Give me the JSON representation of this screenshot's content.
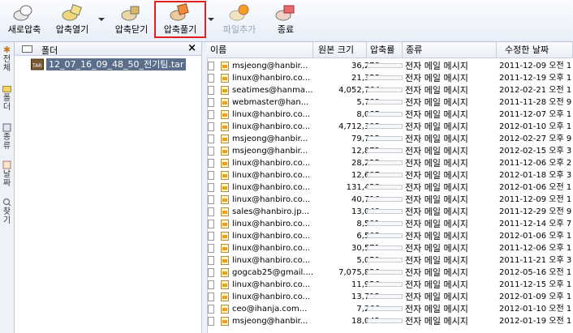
{
  "toolbar": {
    "new_label": "새로압축",
    "open_label": "압축열기",
    "close_label": "압축닫기",
    "extract_label": "압축풀기",
    "add_label": "파일추가",
    "exit_label": "종료"
  },
  "vtabs": {
    "all": "전체",
    "folder": "폴더",
    "type": "종류",
    "date": "날짜",
    "find": "찾기"
  },
  "folder_pane": {
    "title": "폴더",
    "close": "×",
    "item": "12_07_16_09_48_50_전기팀.tar"
  },
  "list": {
    "columns": {
      "name": "이름",
      "size": "원본 크기",
      "ratio": "압축률",
      "type": "종류",
      "date": "수정한 날짜"
    },
    "rows": [
      {
        "name": "msjeong@hanbir...",
        "size": "36,278",
        "type": "전자 메일 메시지",
        "date": "2011-12-09 오전 1"
      },
      {
        "name": "linux@hanbiro.co...",
        "size": "21,353",
        "type": "전자 메일 메시지",
        "date": "2011-12-19 오후 1"
      },
      {
        "name": "seatimes@hanma...",
        "size": "4,052,764",
        "type": "전자 메일 메시지",
        "date": "2012-02-21 오전 1"
      },
      {
        "name": "webmaster@han...",
        "size": "5,789",
        "type": "전자 메일 메시지",
        "date": "2011-11-28 오전 9"
      },
      {
        "name": "linux@hanbiro.co...",
        "size": "8,085",
        "type": "전자 메일 메시지",
        "date": "2011-12-07 오후 1"
      },
      {
        "name": "linux@hanbiro.co...",
        "size": "4,712,393",
        "type": "전자 메일 메시지",
        "date": "2012-01-10 오후 1"
      },
      {
        "name": "msjeong@hanbir...",
        "size": "79,712",
        "type": "전자 메일 메시지",
        "date": "2012-02-27 오후 9"
      },
      {
        "name": "msjeong@hanbir...",
        "size": "12,872",
        "type": "전자 메일 메시지",
        "date": "2012-02-15 오후 3"
      },
      {
        "name": "linux@hanbiro.co...",
        "size": "28,225",
        "type": "전자 메일 메시지",
        "date": "2011-12-06 오후 2"
      },
      {
        "name": "linux@hanbiro.co...",
        "size": "12,697",
        "type": "전자 메일 메시지",
        "date": "2012-01-18 오후 3"
      },
      {
        "name": "linux@hanbiro.co...",
        "size": "131,428",
        "type": "전자 메일 메시지",
        "date": "2012-01-06 오전 1"
      },
      {
        "name": "linux@hanbiro.co...",
        "size": "40,716",
        "type": "전자 메일 메시지",
        "date": "2011-12-09 오전 1"
      },
      {
        "name": "sales@hanbiro.jp...",
        "size": "13,040",
        "type": "전자 메일 메시지",
        "date": "2011-12-29 오전 9"
      },
      {
        "name": "linux@hanbiro.co...",
        "size": "8,591",
        "type": "전자 메일 메시지",
        "date": "2011-12-14 오후 7"
      },
      {
        "name": "linux@hanbiro.co...",
        "size": "6,503",
        "type": "전자 메일 메시지",
        "date": "2012-01-06 오후 1"
      },
      {
        "name": "linux@hanbiro.co...",
        "size": "30,571",
        "type": "전자 메일 메시지",
        "date": "2011-12-06 오후 1"
      },
      {
        "name": "linux@hanbiro.co...",
        "size": "5,059",
        "type": "전자 메일 메시지",
        "date": "2011-11-21 오후 3"
      },
      {
        "name": "gogcab25@gmail....",
        "size": "7,075,826",
        "type": "전자 메일 메시지",
        "date": "2012-05-16 오전 1"
      },
      {
        "name": "linux@hanbiro.co...",
        "size": "11,926",
        "type": "전자 메일 메시지",
        "date": "2011-12-15 오후 1"
      },
      {
        "name": "linux@hanbiro.co...",
        "size": "13,712",
        "type": "전자 메일 메시지",
        "date": "2012-01-09 오후 1"
      },
      {
        "name": "ceo@ihanja.com...",
        "size": "7,266",
        "type": "전자 메일 메시지",
        "date": "2012-01-10 오전 1"
      },
      {
        "name": "msjeong@hanbir...",
        "size": "18,042",
        "type": "전자 메일 메시지",
        "date": "2012-01-19 오전 1"
      }
    ]
  },
  "colors": {
    "highlight": "#e02020",
    "selection": "#5a6e8c",
    "toolbar_bg": "#e8eef8"
  },
  "icons": [
    "new-archive-icon",
    "open-archive-icon",
    "close-archive-icon",
    "extract-icon",
    "add-file-icon",
    "exit-icon",
    "star-icon",
    "folder-icon",
    "tar-file-icon",
    "email-file-icon"
  ]
}
